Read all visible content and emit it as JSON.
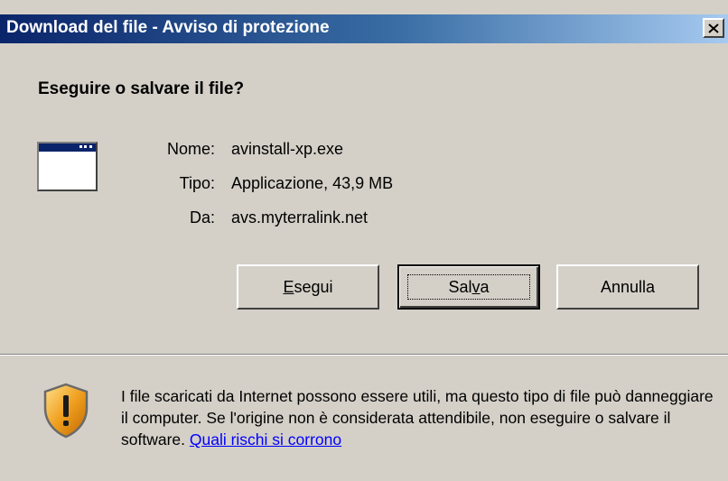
{
  "window": {
    "title": "Download del file - Avviso di protezione",
    "close_label": "×"
  },
  "heading": "Eseguire o salvare il file?",
  "file": {
    "icon": "application-window-icon",
    "rows": [
      {
        "label": "Nome:",
        "value": "avinstall-xp.exe"
      },
      {
        "label": "Tipo:",
        "value": "Applicazione, 43,9 MB"
      },
      {
        "label": "Da:",
        "value": "avs.myterralink.net"
      }
    ]
  },
  "buttons": {
    "run": {
      "prefix": "",
      "accel": "E",
      "suffix": "segui"
    },
    "save": {
      "prefix": "Sal",
      "accel": "v",
      "suffix": "a"
    },
    "cancel": {
      "label": "Annulla"
    }
  },
  "warning": {
    "icon": "security-shield-icon",
    "text": "I file scaricati da Internet possono essere utili, ma questo tipo di file può danneggiare il computer. Se l'origine non è considerata attendibile, non eseguire o salvare il software. ",
    "link": "Quali rischi si corrono"
  },
  "colors": {
    "titlebar_start": "#0a246a",
    "titlebar_end": "#a6caf0",
    "dialog_bg": "#d4d0c8",
    "link": "#0000ff",
    "shield_orange": "#f0a020"
  }
}
